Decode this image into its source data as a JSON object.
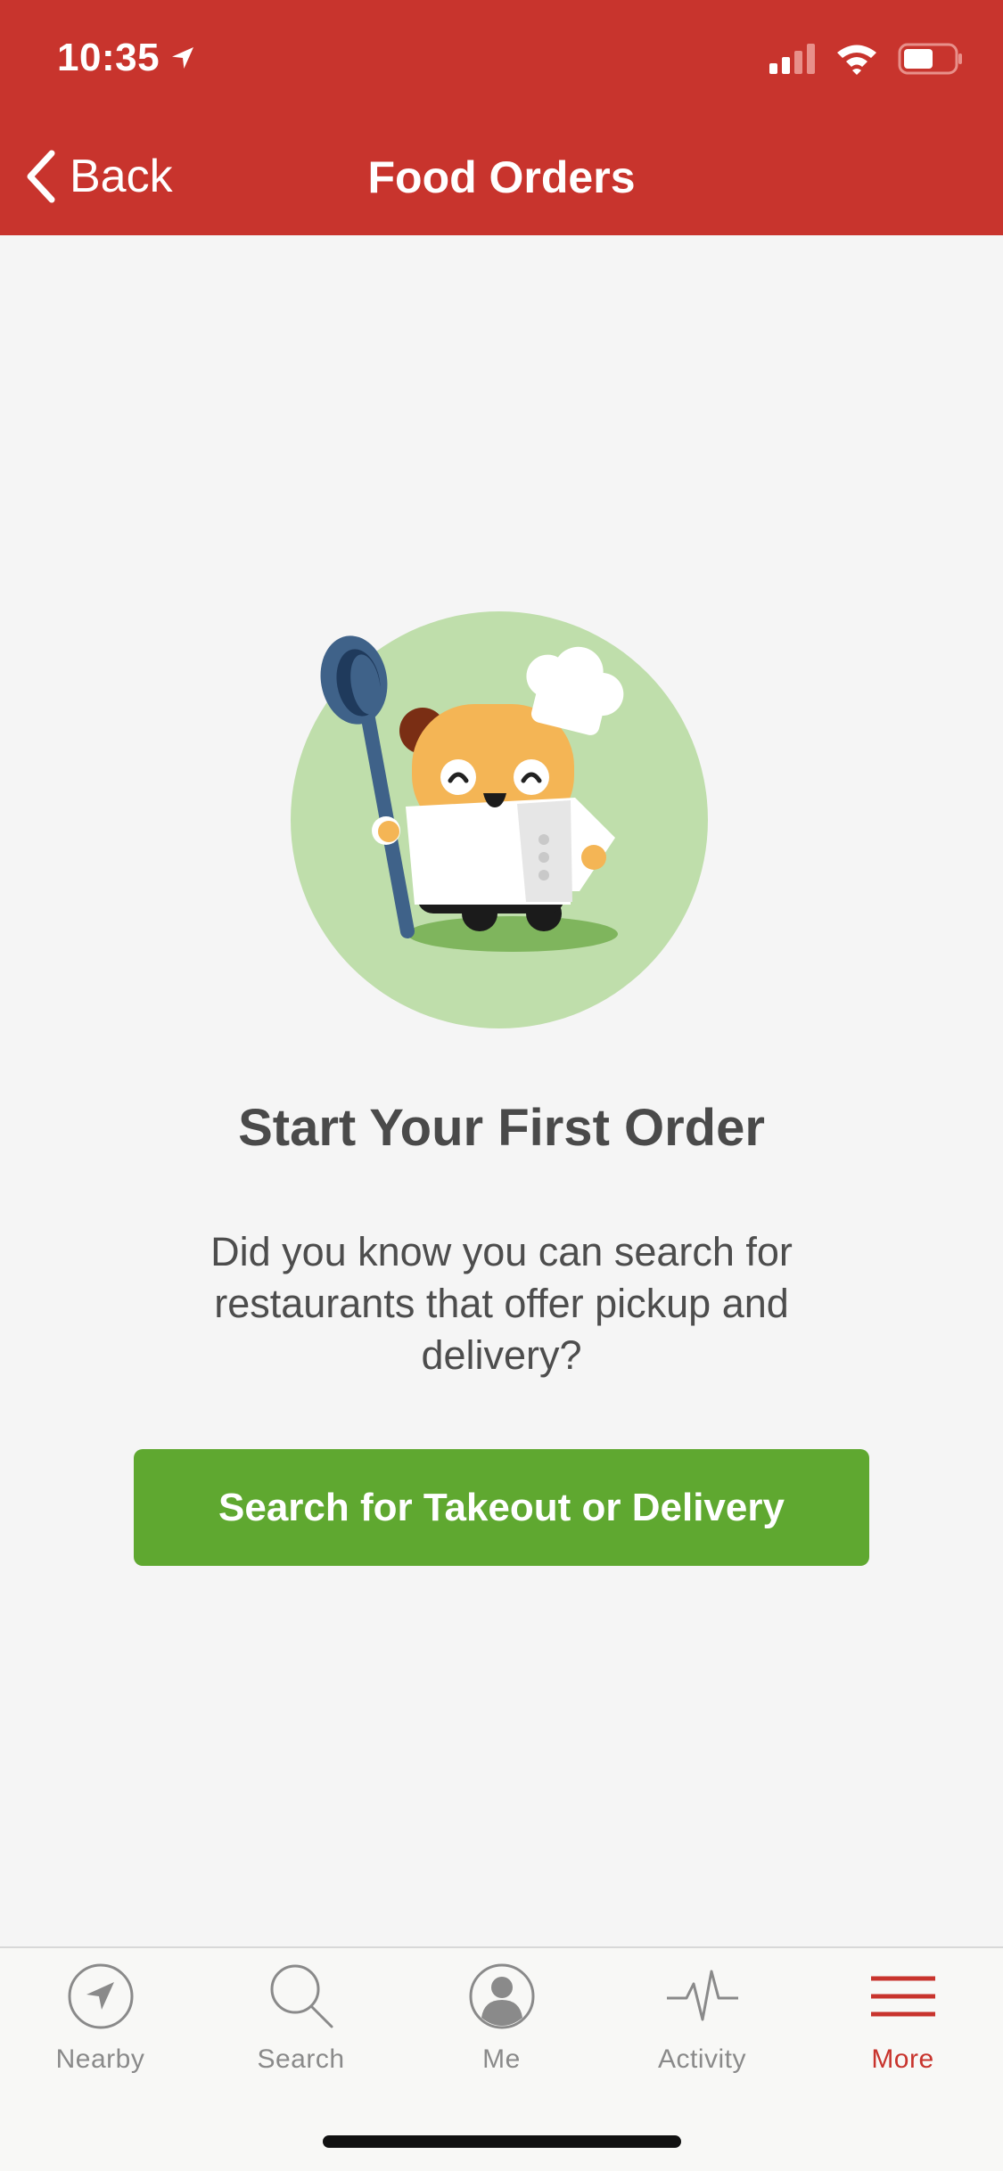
{
  "status_bar": {
    "time": "10:35"
  },
  "nav": {
    "back_label": "Back",
    "title": "Food Orders"
  },
  "empty_state": {
    "headline": "Start Your First Order",
    "body": "Did you know you can search for restaurants that offer pickup and delivery?",
    "cta_label": "Search for Takeout or Delivery"
  },
  "tabbar": {
    "items": [
      {
        "label": "Nearby",
        "icon": "navigation-arrow-icon",
        "active": false
      },
      {
        "label": "Search",
        "icon": "search-icon",
        "active": false
      },
      {
        "label": "Me",
        "icon": "profile-icon",
        "active": false
      },
      {
        "label": "Activity",
        "icon": "activity-pulse-icon",
        "active": false
      },
      {
        "label": "More",
        "icon": "hamburger-menu-icon",
        "active": true
      }
    ]
  },
  "colors": {
    "brand_red": "#c8342d",
    "cta_green": "#5fa830",
    "illustration_bg": "#bfdeab",
    "background": "#f5f5f5"
  }
}
